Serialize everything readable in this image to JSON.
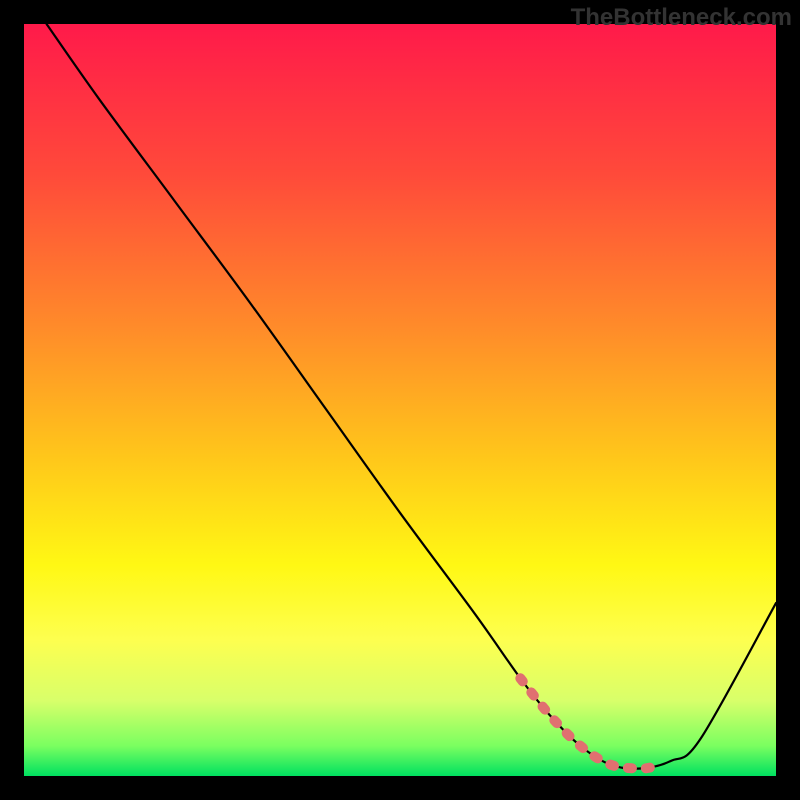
{
  "watermark": "TheBottleneck.com",
  "chart_data": {
    "type": "line",
    "title": "",
    "xlabel": "",
    "ylabel": "",
    "xlim": [
      0,
      100
    ],
    "ylim": [
      0,
      100
    ],
    "series": [
      {
        "name": "bottleneck-curve",
        "x": [
          3,
          10,
          20,
          30,
          40,
          50,
          60,
          66,
          70,
          74,
          78,
          82,
          86,
          90,
          100
        ],
        "values": [
          100,
          90,
          76.5,
          63,
          49,
          35,
          21.5,
          13,
          8,
          4,
          1.5,
          1,
          2,
          5,
          23
        ]
      }
    ],
    "highlight_segment": {
      "name": "optimal-range",
      "x": [
        66,
        70,
        74,
        78,
        82,
        84
      ],
      "values": [
        13,
        8,
        4,
        1.5,
        1,
        1.3
      ],
      "color": "#e07070"
    },
    "gradient_stops": [
      {
        "offset": 0.0,
        "color": "#ff1a4a"
      },
      {
        "offset": 0.2,
        "color": "#ff4a3a"
      },
      {
        "offset": 0.4,
        "color": "#ff8a2a"
      },
      {
        "offset": 0.58,
        "color": "#ffc81a"
      },
      {
        "offset": 0.72,
        "color": "#fff814"
      },
      {
        "offset": 0.82,
        "color": "#fdff50"
      },
      {
        "offset": 0.9,
        "color": "#d8ff6a"
      },
      {
        "offset": 0.96,
        "color": "#7aff60"
      },
      {
        "offset": 1.0,
        "color": "#00e060"
      }
    ]
  }
}
